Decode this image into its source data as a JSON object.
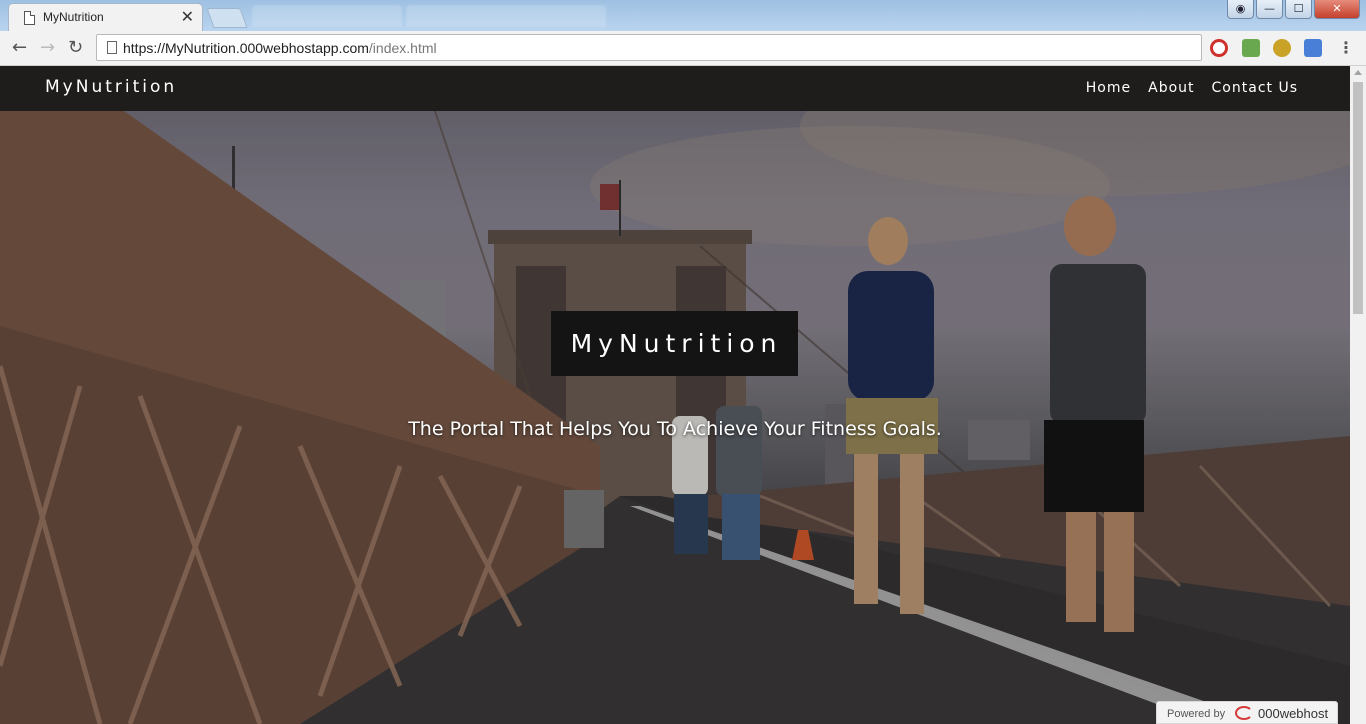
{
  "browser": {
    "tab_title": "MyNutrition",
    "close_tab": "✕",
    "url_host": "https://MyNutrition.000webhostapp.com",
    "url_path": "/index.html",
    "window_buttons": {
      "minimize": "—",
      "maximize": "☐",
      "close": "✕"
    },
    "extension_icons": [
      "opera-icon",
      "extension-icon",
      "vpn-icon",
      "translate-icon"
    ]
  },
  "site": {
    "brand": "MyNutrition",
    "nav": [
      {
        "label": "Home"
      },
      {
        "label": "About"
      },
      {
        "label": "Contact Us"
      }
    ],
    "hero_title": "MyNutrition",
    "tagline": "The Portal That Helps You To Achieve Your Fitness Goals."
  },
  "badge": {
    "label": "Powered by",
    "name": "000webhost"
  }
}
